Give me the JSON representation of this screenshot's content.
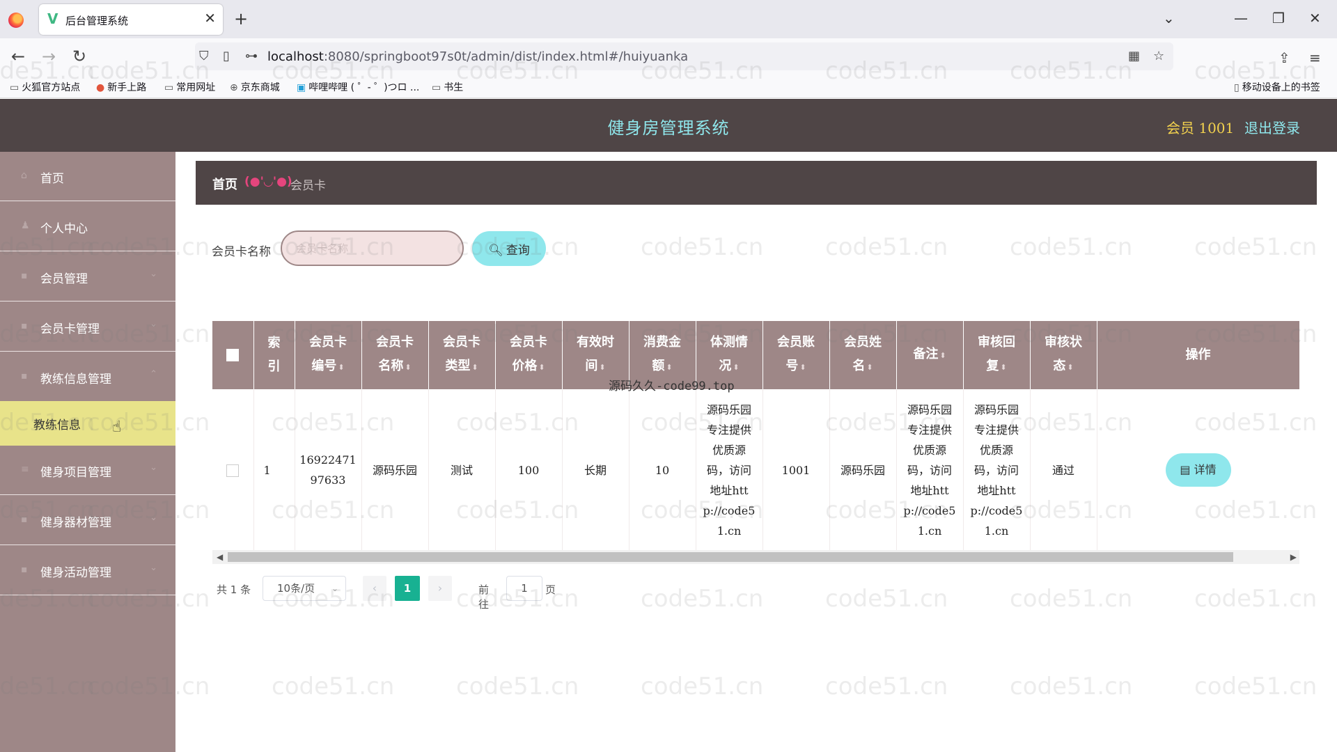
{
  "browser": {
    "tab_title": "后台管理系统",
    "tab_close": "✕",
    "new_tab": "+",
    "url_host": "localhost",
    "url_path": ":8080/springboot97s0t/admin/dist/index.html#/huiyuanka",
    "bookmarks": [
      "火狐官方站点",
      "新手上路",
      "常用网址",
      "京东商城",
      "哔哩哔哩 ( ゜- ゜)つロ ...",
      "书生"
    ],
    "mobile_bookmarks": "移动设备上的书签"
  },
  "header": {
    "title": "健身房管理系统",
    "user": "会员 1001",
    "logout": "退出登录"
  },
  "sidebar": {
    "items": [
      {
        "label": "首页"
      },
      {
        "label": "个人中心"
      },
      {
        "label": "会员管理"
      },
      {
        "label": "会员卡管理"
      },
      {
        "label": "教练信息管理"
      },
      {
        "label": "教练信息"
      },
      {
        "label": "健身项目管理"
      },
      {
        "label": "健身器材管理"
      },
      {
        "label": "健身活动管理"
      }
    ]
  },
  "breadcrumb": {
    "home": "首页",
    "separator": "(●'◡'●)",
    "current": "会员卡"
  },
  "search": {
    "label": "会员卡名称",
    "placeholder": "会员卡名称",
    "button": "查询"
  },
  "table": {
    "headers": [
      {
        "line1": "索",
        "line2": "引"
      },
      {
        "line1": "会员卡",
        "line2": "编号"
      },
      {
        "line1": "会员卡",
        "line2": "名称"
      },
      {
        "line1": "会员卡",
        "line2": "类型"
      },
      {
        "line1": "会员卡",
        "line2": "价格"
      },
      {
        "line1": "有效时",
        "line2": "间"
      },
      {
        "line1": "消费金",
        "line2": "额"
      },
      {
        "line1": "体测情",
        "line2": "况"
      },
      {
        "line1": "会员账",
        "line2": "号"
      },
      {
        "line1": "会员姓",
        "line2": "名"
      },
      {
        "line1": "备注",
        "line2": ""
      },
      {
        "line1": "审核回",
        "line2": "复"
      },
      {
        "line1": "审核状",
        "line2": "态"
      },
      {
        "line1": "操作",
        "line2": ""
      }
    ],
    "rows": [
      {
        "index": "1",
        "card_no_1": "16922471",
        "card_no_2": "97633",
        "card_name": "源码乐园",
        "card_type": "测试",
        "price": "100",
        "validity": "长期",
        "spend": "10",
        "body_test": [
          "源码乐园",
          "专注提供",
          "优质源",
          "码，访问",
          "地址htt",
          "p://code5",
          "1.cn"
        ],
        "account": "1001",
        "member_name": "源码乐园",
        "remark": [
          "源码乐园",
          "专注提供",
          "优质源",
          "码，访问",
          "地址htt",
          "p://code5",
          "1.cn"
        ],
        "review_reply": [
          "源码乐园",
          "专注提供",
          "优质源",
          "码，访问",
          "地址htt",
          "p://code5",
          "1.cn"
        ],
        "review_status": "通过",
        "action": "详情"
      }
    ],
    "overlay_note": "源码久久-code99.top"
  },
  "pagination": {
    "total": "共 1 条",
    "page_size": "10条/页",
    "current_page": "1",
    "goto_label": "前往",
    "goto_value": "1",
    "goto_unit": "页"
  },
  "watermark_text": "code51.cn",
  "colors": {
    "header_bg": "#4f4546",
    "sidebar_bg": "#9e8787",
    "accent_cyan": "#8fe7ec",
    "active_item": "#e8e38a",
    "pager_active": "#18b192"
  }
}
